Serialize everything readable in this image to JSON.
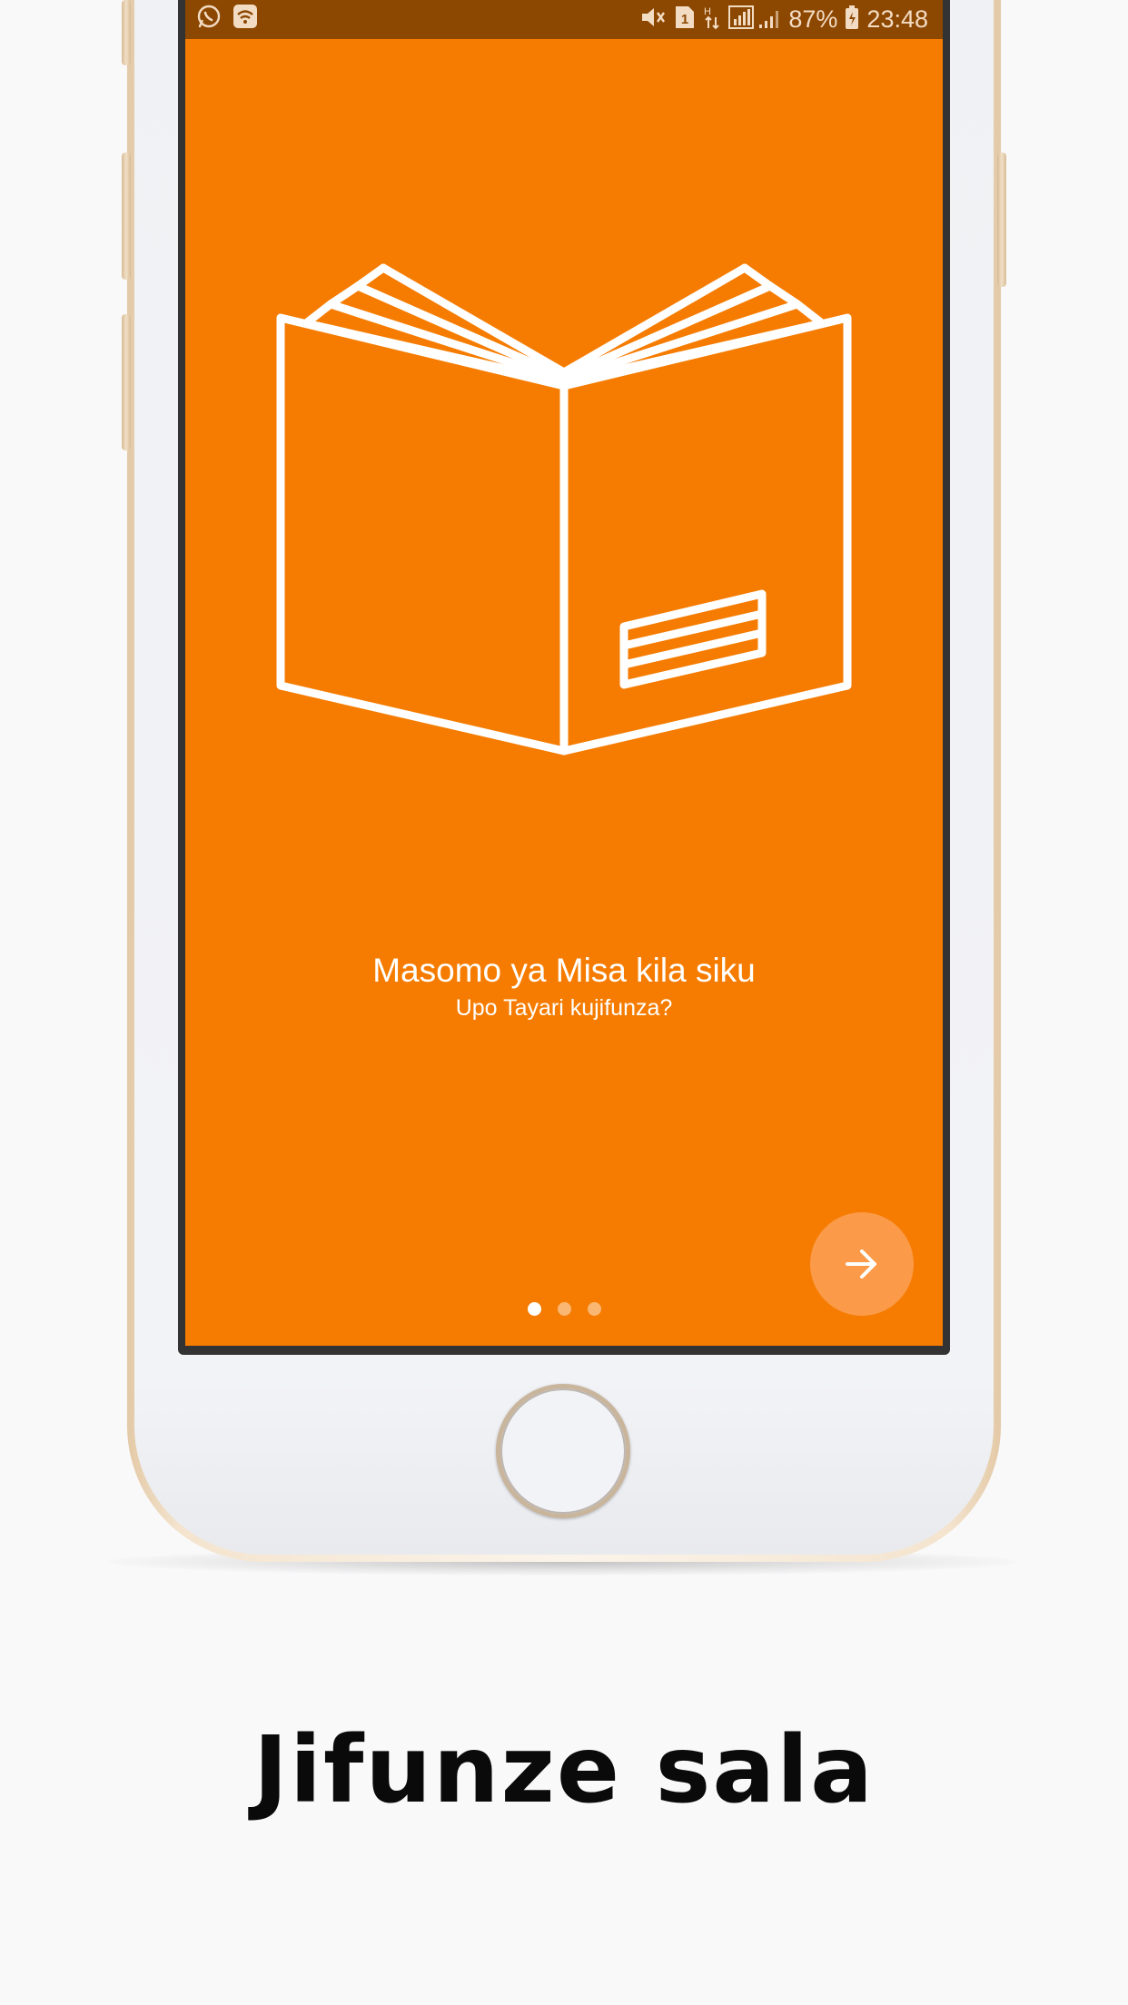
{
  "status_bar": {
    "left_icons": [
      "whatsapp-icon",
      "wifi-notification-icon"
    ],
    "right_icons": [
      "mute-icon",
      "sim-icon",
      "data-arrows-icon",
      "signal-icon"
    ],
    "battery": "87%",
    "time": "23:48"
  },
  "onboarding": {
    "illustration": "open-book-icon",
    "headline": "Masomo ya Misa kila siku",
    "subline": "Upo Tayari kujifunza?",
    "next_icon": "arrow-right-icon",
    "pages_total": 3,
    "current_page": 1
  },
  "caption": "Jifunze sala",
  "colors": {
    "screen_bg": "#f57c00",
    "status_bar_bg": "#8c4700",
    "fab_bg": "#fb9a48",
    "text": "#ffffff",
    "caption_text": "#0a0a0a"
  }
}
